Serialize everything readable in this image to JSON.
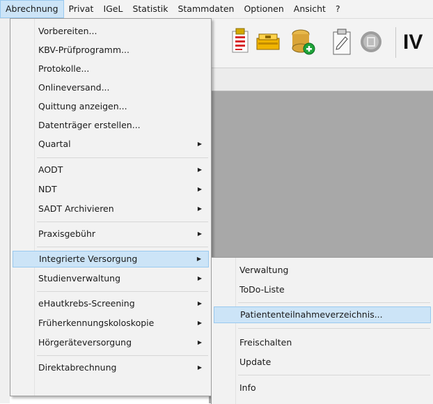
{
  "menubar": [
    "Abrechnung",
    "Privat",
    "IGeL",
    "Statistik",
    "Stammdaten",
    "Optionen",
    "Ansicht",
    "?"
  ],
  "toolbar": {
    "iv_label": "IV"
  },
  "menu": {
    "items": [
      {
        "label": "Vorbereiten..."
      },
      {
        "label": "KBV-Prüfprogramm..."
      },
      {
        "label": "Protokolle..."
      },
      {
        "label": "Onlineversand..."
      },
      {
        "label": "Quittung anzeigen..."
      },
      {
        "label": "Datenträger erstellen..."
      },
      {
        "label": "Quartal",
        "arrow": "▶"
      },
      {
        "label": "AODT",
        "arrow": "▶"
      },
      {
        "label": "NDT",
        "arrow": "▶"
      },
      {
        "label": "SADT Archivieren",
        "arrow": "▶"
      },
      {
        "label": "Praxisgebühr",
        "arrow": "▶"
      },
      {
        "label": "Integrierte Versorgung",
        "arrow": "▶"
      },
      {
        "label": "Studienverwaltung",
        "arrow": "▶"
      },
      {
        "label": "eHautkrebs-Screening",
        "arrow": "▶"
      },
      {
        "label": "Früherkennungskoloskopie",
        "arrow": "▶"
      },
      {
        "label": "Hörgeräteversorgung",
        "arrow": "▶"
      },
      {
        "label": "Direktabrechnung",
        "arrow": "▶"
      }
    ]
  },
  "submenu": {
    "items": [
      {
        "label": "Verwaltung"
      },
      {
        "label": "ToDo-Liste"
      },
      {
        "label": "Patiententeilnahmeverzeichnis..."
      },
      {
        "label": "Freischalten"
      },
      {
        "label": "Update"
      },
      {
        "label": "Info"
      }
    ]
  }
}
